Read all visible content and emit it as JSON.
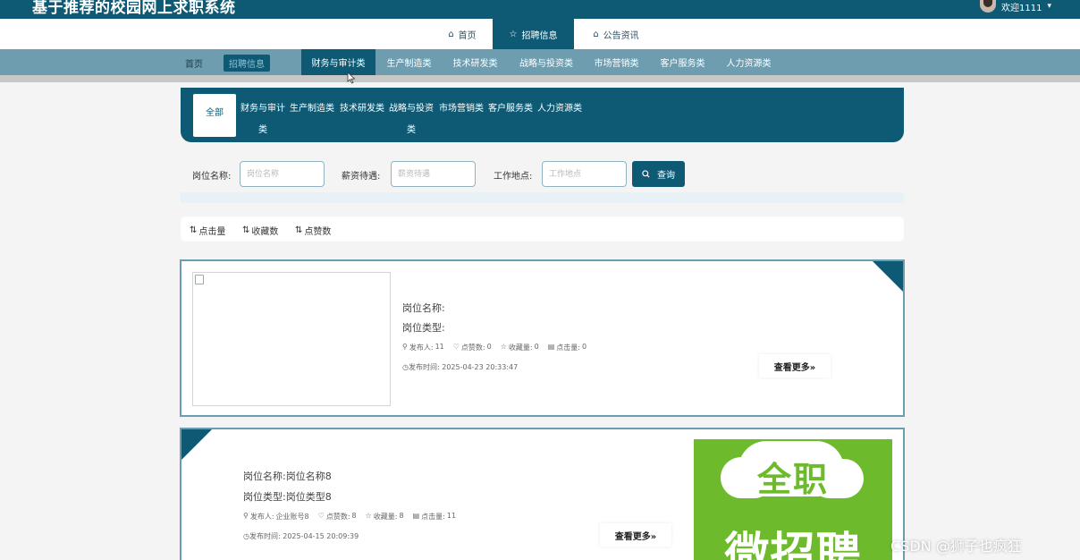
{
  "header": {
    "site_title": "基于推荐的校园网上求职系统",
    "user_name": "欢迎1111",
    "caret": "▾"
  },
  "main_nav": [
    {
      "icon": "⌂",
      "label": "首页"
    },
    {
      "icon": "☆",
      "label": "招聘信息"
    },
    {
      "icon": "⌂",
      "label": "公告资讯"
    }
  ],
  "breadcrumb": {
    "home": "首页",
    "current": "招聘信息"
  },
  "sub_nav": [
    "财务与审计类",
    "生产制造类",
    "技术研发类",
    "战略与投资类",
    "市场营销类",
    "客户服务类",
    "人力资源类"
  ],
  "category_panel": {
    "all": "全部",
    "items": [
      "财务与审计类",
      "生产制造类",
      "技术研发类",
      "战略与投资类",
      "市场营销类",
      "客户服务类",
      "人力资源类"
    ]
  },
  "filters": {
    "job_name_label": "岗位名称:",
    "job_name_placeholder": "岗位名称",
    "salary_label": "薪资待遇:",
    "salary_placeholder": "薪资待遇",
    "location_label": "工作地点:",
    "location_placeholder": "工作地点",
    "search_label": "查询"
  },
  "sort_bar": [
    "点击量",
    "收藏数",
    "点赞数"
  ],
  "jobs": [
    {
      "name": "岗位名称:",
      "type": "岗位类型:",
      "publisher_label": "发布人:",
      "publisher": "11",
      "likes_label": "点赞数:",
      "likes": "0",
      "favorites_label": "收藏量:",
      "favorites": "0",
      "clicks_label": "点击量:",
      "clicks": "0",
      "time_label": "发布时间:",
      "time": "2025-04-23 20:33:47",
      "more": "查看更多»"
    },
    {
      "name": "岗位名称:岗位名称8",
      "type": "岗位类型:岗位类型8",
      "publisher_label": "发布人:",
      "publisher": "企业账号8",
      "likes_label": "点赞数:",
      "likes": "8",
      "favorites_label": "收藏量:",
      "favorites": "8",
      "clicks_label": "点击量:",
      "clicks": "11",
      "time_label": "发布时间:",
      "time": "2025-04-15 20:09:39",
      "more": "查看更多»",
      "ad_top": "全职",
      "ad_bottom": "微招聘"
    }
  ],
  "watermark": "CSDN @狮子也疯狂",
  "colors": {
    "primary": "#0e5a74",
    "subnav": "#6f9db0",
    "card_border": "#6b9db1",
    "ad_green": "#6dbb2d"
  }
}
